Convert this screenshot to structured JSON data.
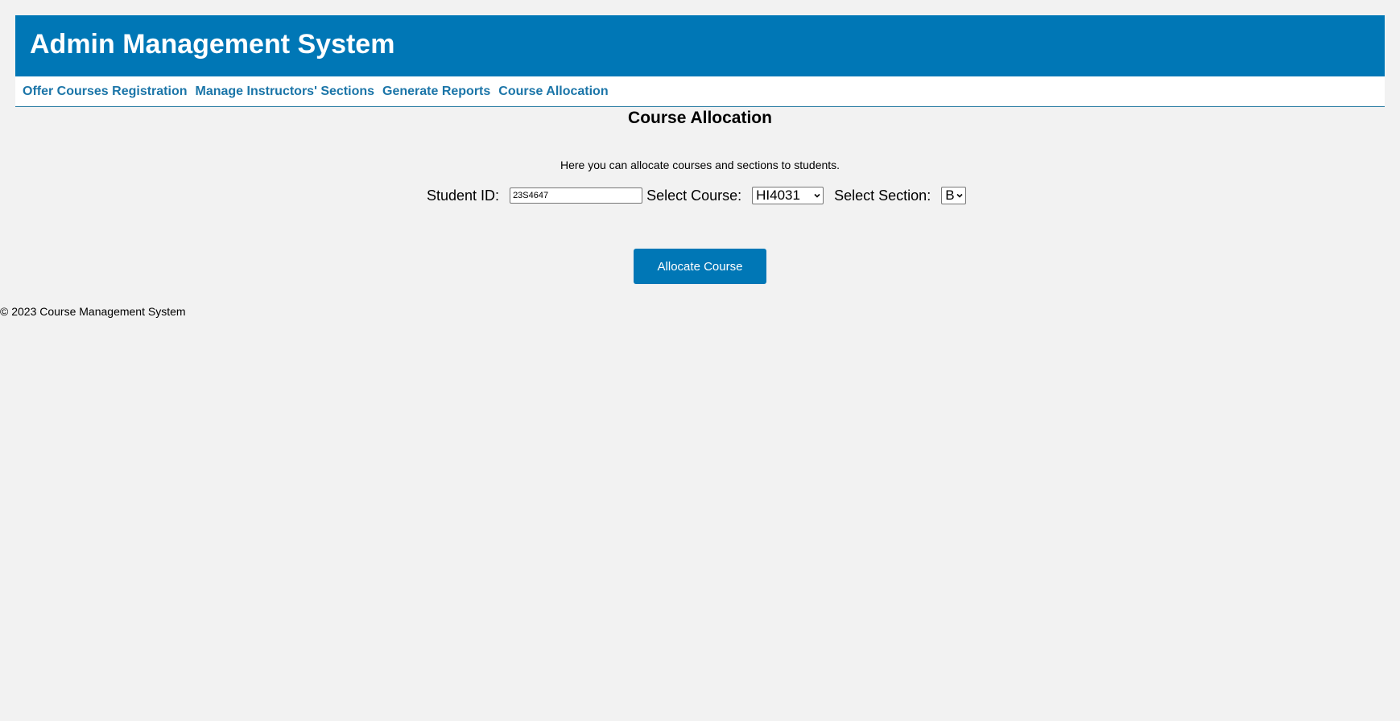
{
  "header": {
    "title": "Admin Management System"
  },
  "nav": {
    "items": [
      {
        "label": "Offer Courses Registration"
      },
      {
        "label": "Manage Instructors' Sections"
      },
      {
        "label": "Generate Reports"
      },
      {
        "label": "Course Allocation"
      }
    ]
  },
  "main": {
    "title": "Course Allocation",
    "description": "Here you can allocate courses and sections to students.",
    "form": {
      "student_id_label": "Student ID:",
      "student_id_value": "23S4647",
      "course_label": "Select Course:",
      "course_value": "HI4031",
      "section_label": "Select Section:",
      "section_value": "B",
      "submit_label": "Allocate Course"
    }
  },
  "footer": {
    "text": "© 2023 Course Management System"
  },
  "colors": {
    "header_bg": "#0077b6",
    "nav_link": "#1b75a8",
    "page_bg": "#f2f2f2",
    "button_bg": "#0077b6"
  }
}
